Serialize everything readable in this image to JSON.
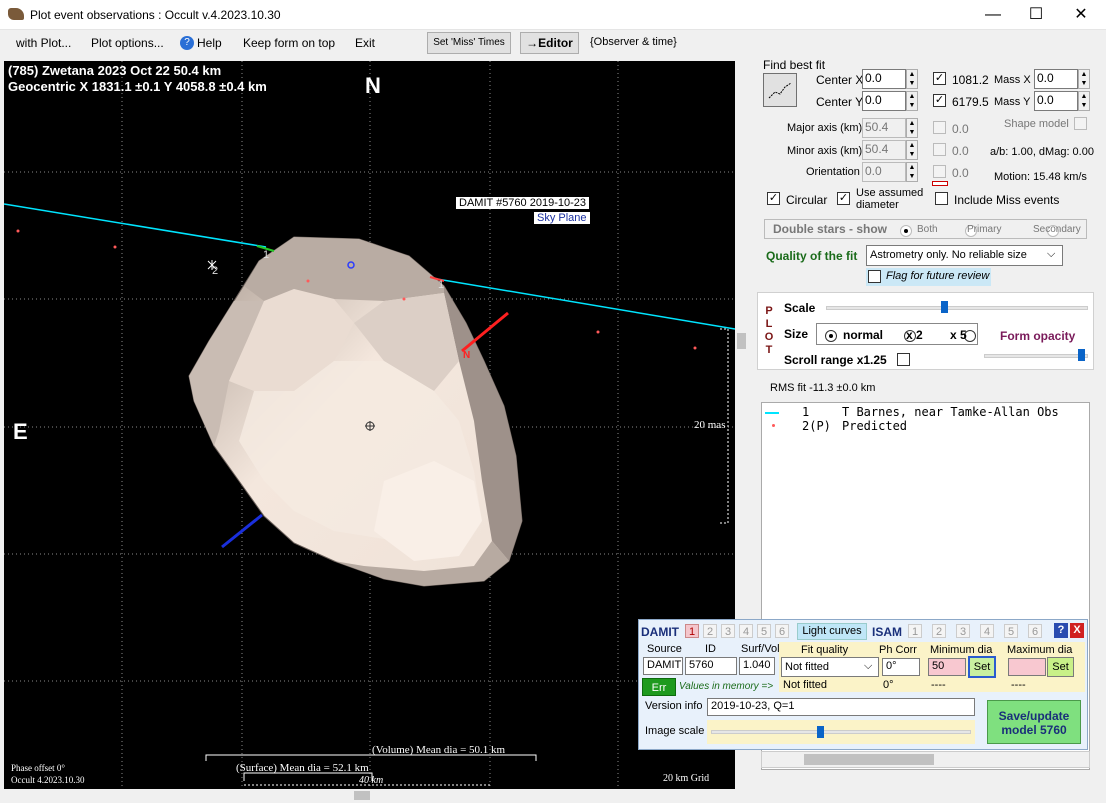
{
  "window": {
    "title": "Plot event observations : Occult v.4.2023.10.30",
    "controls": {
      "minimize": "—",
      "maximize": "☐",
      "close": "✕"
    }
  },
  "menu": {
    "with_plot": "with Plot...",
    "plot_options": "Plot options...",
    "help": "Help",
    "keep_form_on_top": "Keep form on top",
    "exit": "Exit",
    "set_miss_times": "Set 'Miss' Times",
    "editor": "→Editor",
    "observer_time": "{Observer & time}"
  },
  "plot": {
    "header_line1": "(785) Zwetana  2023 Oct 22   50.4 km",
    "header_line2": "Geocentric  X  1831.1 ±0.1  Y 4058.8 ±0.4 km",
    "north_label": "N",
    "east_label": "E",
    "damit_label": "DAMIT #5760 2019-10-23",
    "sky_plane_label": "Sky Plane",
    "scale_20mas": "20 mas",
    "chord_label_left": "1",
    "chord_label_right": "1",
    "point2_label": "2",
    "pole_label": "N",
    "volume_mean_dia": "(Volume) Mean dia = 50.1 km",
    "surface_mean_dia": "(Surface) Mean dia = 52.1 km",
    "scale_40km": "40 km",
    "phase_offset": "Phase offset 0°",
    "occult_version": "Occult 4.2023.10.30",
    "grid_label": "20 km Grid"
  },
  "fit": {
    "find_best_fit": "Find best fit",
    "center_x_label": "Center X",
    "center_x": "0.0",
    "center_y_label": "Center Y",
    "center_y": "0.0",
    "mass_x_val": "1081.2",
    "mass_x_label": "Mass X",
    "mass_x": "0.0",
    "mass_y_val": "6179.5",
    "mass_y_label": "Mass Y",
    "mass_y": "0.0",
    "major_axis_label": "Major axis (km)",
    "major_axis": "50.4",
    "major_axis_chk": "0.0",
    "minor_axis_label": "Minor axis (km)",
    "minor_axis": "50.4",
    "minor_axis_chk": "0.0",
    "orientation_label": "Orientation",
    "orientation": "0.0",
    "orientation_chk": "0.0",
    "shape_model": "Shape model",
    "ab_dmag": "a/b: 1.00, dMag: 0.00",
    "motion": "Motion: 15.48 km/s",
    "circular": "Circular",
    "use_assumed_line1": "Use assumed",
    "use_assumed_line2": "diameter",
    "include_miss": "Include Miss events",
    "double_stars": "Double stars - show",
    "both": "Both",
    "primary": "Primary",
    "secondary": "Secondary",
    "quality_label": "Quality of the fit",
    "quality_value": "Astrometry only. No reliable size",
    "flag_review": "Flag for future review"
  },
  "plotbox": {
    "plot_vertical": [
      "P",
      "L",
      "O",
      "T"
    ],
    "scale": "Scale",
    "size": "Size",
    "normal": "normal",
    "x2": "x 2",
    "x5": "x 5",
    "form_opacity": "Form opacity",
    "scroll_range": "Scroll range x1.25",
    "scale_level": 0.45,
    "opacity_level": 0.97
  },
  "rms": "RMS fit -11.3 ±0.0 km",
  "observers": [
    {
      "num": "1",
      "name": "T Barnes, near Tamke-Allan Obs"
    },
    {
      "num": "2(P)",
      "name": "Predicted"
    }
  ],
  "damit": {
    "title": "DAMIT",
    "tabs": [
      "1",
      "2",
      "3",
      "4",
      "5",
      "6"
    ],
    "light_curves": "Light curves",
    "isam": "ISAM",
    "isam_tabs": [
      "1",
      "2",
      "3",
      "4",
      "5",
      "6"
    ],
    "help": "?",
    "close": "X",
    "source_label": "Source",
    "id_label": "ID",
    "surf_vol_label": "Surf/Vol",
    "fit_quality_label": "Fit quality",
    "ph_corr_label": "Ph Corr",
    "min_dia_label": "Minimum dia",
    "max_dia_label": "Maximum dia",
    "source": "DAMIT",
    "id": "5760",
    "surf_vol": "1.040",
    "fit_quality": "Not fitted",
    "ph_corr": "0°",
    "min_dia": "50",
    "max_dia": "",
    "set": "Set",
    "err": "Err",
    "values_in_memory": "Values in memory =>",
    "mem_fit_quality": "Not fitted",
    "mem_ph_corr": "0°",
    "mem_min": "----",
    "mem_max": "----",
    "version_info_label": "Version info",
    "version_info": "2019-10-23, Q=1",
    "image_scale_label": "Image scale",
    "image_scale_level": 0.42,
    "save_update": "Save/update model 5760"
  },
  "colors": {
    "chord": "#00e5ff",
    "asteroid_light": "#f3e6dc",
    "asteroid_dark": "#8f827a",
    "pole_north": "#ff2020",
    "pole_south": "#1a2fdc",
    "save_button": "#7fe07f",
    "err_button": "#1e9a1e"
  }
}
